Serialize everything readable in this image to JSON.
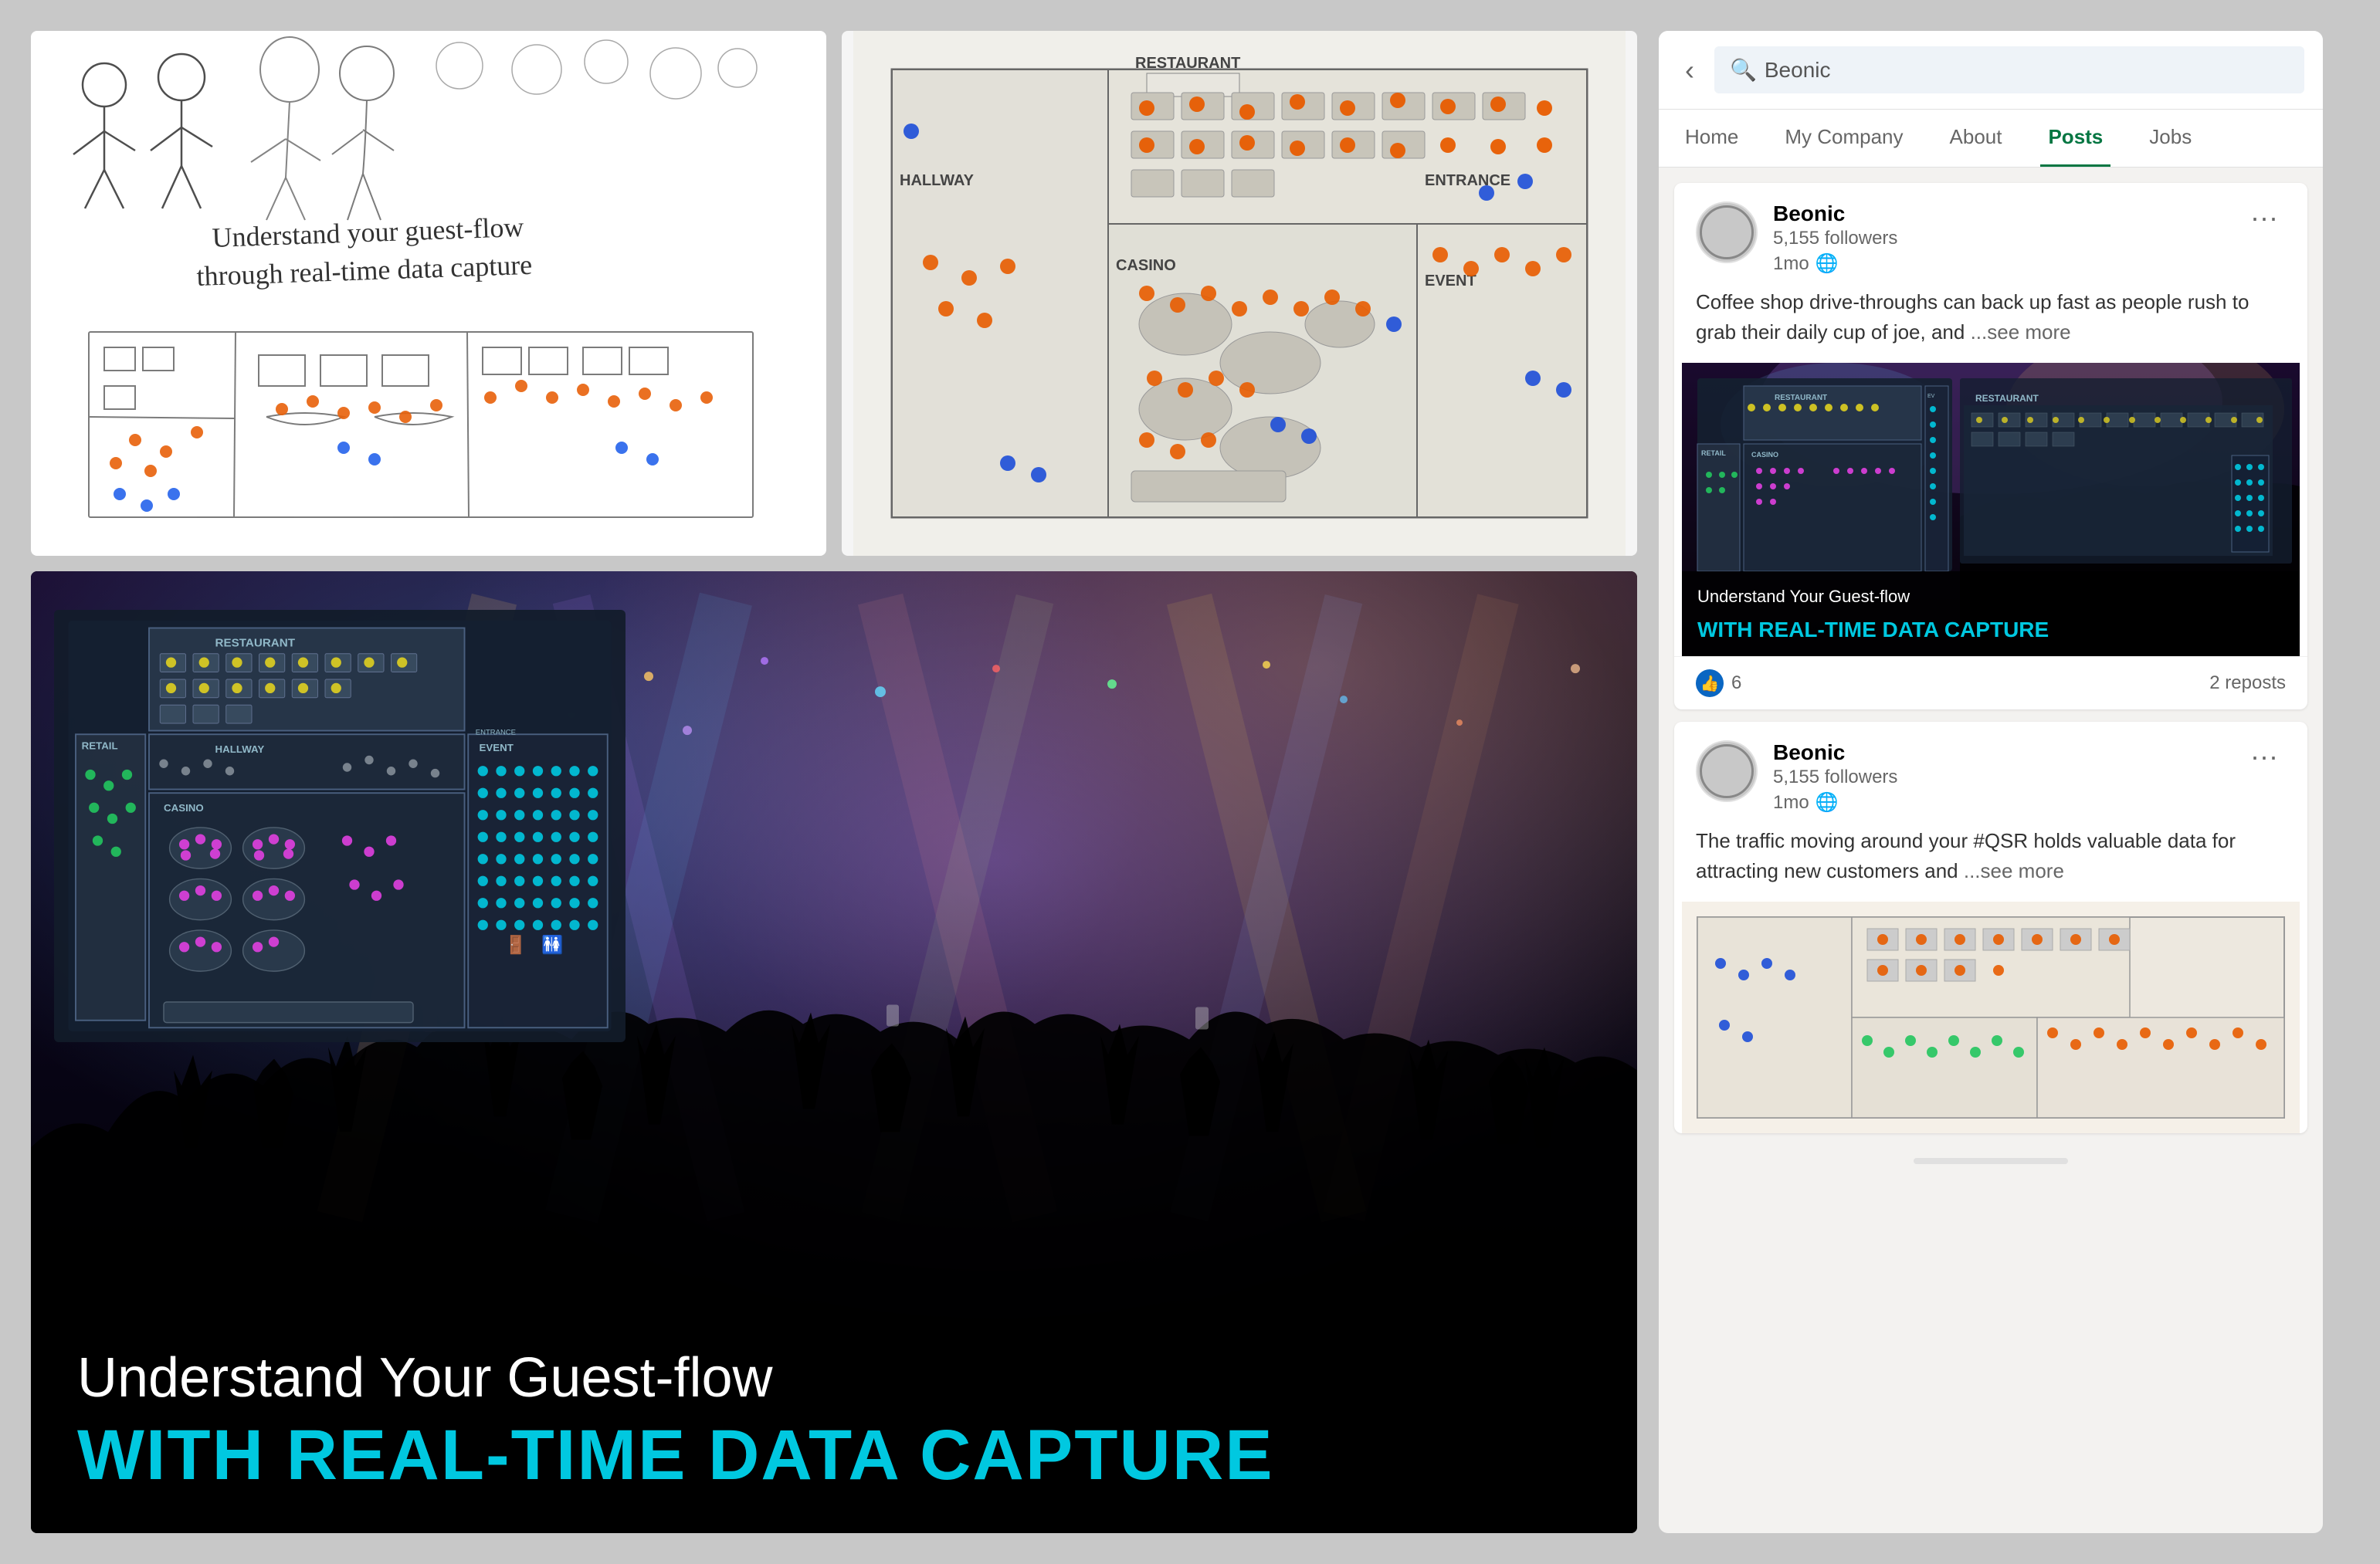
{
  "page": {
    "background_color": "#c8c8c8"
  },
  "top_left_image": {
    "alt": "Hand-drawn sketch of floor plan with guest flow data",
    "handwriting_line1": "Understand your guest-flow",
    "handwriting_line2": "through real-time data capture"
  },
  "top_right_image": {
    "alt": "Floor plan with orange and blue dots showing visitor positions"
  },
  "large_image": {
    "alt": "Concert crowd with floor plan overlay",
    "title_line1": "Understand Your Guest-flow",
    "title_line2": "WITH REAL-TIME DATA CAPTURE",
    "floorplan_labels": {
      "restaurant": "RESTAURANT",
      "retail": "RETAIL",
      "hallway": "HALLWAY",
      "casino": "CASINO",
      "event": "EVENT",
      "entrance": "ENTRANCE"
    }
  },
  "linkedin": {
    "search_placeholder": "Beonic",
    "back_icon": "‹",
    "nav_items": [
      {
        "label": "Home",
        "active": false
      },
      {
        "label": "My Company",
        "active": false
      },
      {
        "label": "About",
        "active": false
      },
      {
        "label": "Posts",
        "active": true
      },
      {
        "label": "Jobs",
        "active": false
      }
    ],
    "posts": [
      {
        "id": "post1",
        "company": "Beonic",
        "followers": "5,155 followers",
        "time": "1mo",
        "globe_icon": "🌐",
        "text": "Coffee shop drive-throughs can back up fast as people rush to grab their daily cup of joe, and",
        "see_more": "...see more",
        "image_alt": "Understand Your Guest-flow WITH REAL-TIME DATA CAPTURE",
        "image_title_line1": "Understand Your Guest-flow",
        "image_title_line2": "WITH REAL-TIME DATA CAPTURE",
        "reactions_count": "6",
        "reposts": "2 reposts"
      },
      {
        "id": "post2",
        "company": "Beonic",
        "followers": "5,155 followers",
        "time": "1mo",
        "globe_icon": "🌐",
        "text": "The traffic moving around your #QSR holds valuable data for attracting new customers and",
        "see_more": "...see more",
        "image_alt": "QSR floor plan visualization"
      }
    ],
    "more_button_label": "···"
  }
}
